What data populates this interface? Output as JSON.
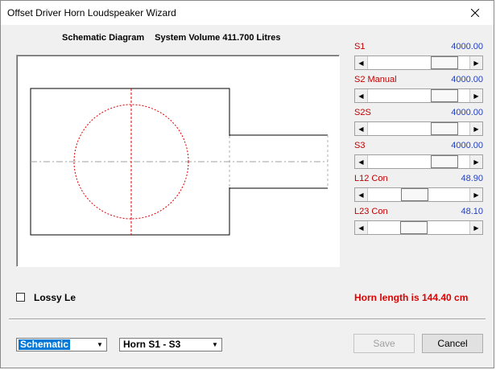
{
  "window": {
    "title": "Offset Driver Horn Loudspeaker Wizard"
  },
  "diagram": {
    "heading": "Schematic Diagram",
    "volume": "System Volume 411.700 Litres"
  },
  "params": [
    {
      "label": "S1",
      "value": "4000.00",
      "slider_fraction": 0.84
    },
    {
      "label": "S2  Manual",
      "value": "4000.00",
      "slider_fraction": 0.84
    },
    {
      "label": "S2S",
      "value": "4000.00",
      "slider_fraction": 0.84
    },
    {
      "label": "S3",
      "value": "4000.00",
      "slider_fraction": 0.84
    },
    {
      "label": "L12  Con",
      "value": "48.90",
      "slider_fraction": 0.45
    },
    {
      "label": "L23  Con",
      "value": "48.10",
      "slider_fraction": 0.44
    }
  ],
  "lossy": {
    "label": "Lossy Le",
    "checked": false
  },
  "horn_length": "Horn length is 144.40 cm",
  "controls": {
    "view_select": "Schematic",
    "horn_select": "Horn S1 - S3",
    "save_label": "Save",
    "cancel_label": "Cancel"
  },
  "colors": {
    "label_red": "#c00000",
    "value_blue": "#1f3fbf",
    "horn_red": "#e00000",
    "select_highlight": "#0078d7"
  }
}
